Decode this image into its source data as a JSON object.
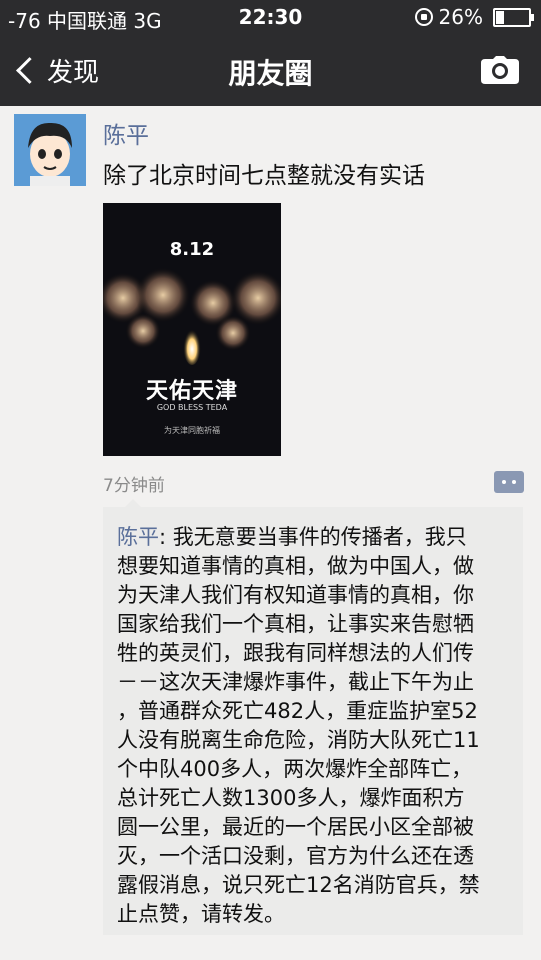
{
  "status": {
    "carrier": "-76 中国联通  3G",
    "time": "22:30",
    "battery": "26%",
    "battery_level": 0.26
  },
  "nav": {
    "back_label": "发现",
    "title": "朋友圈"
  },
  "post": {
    "author": "陈平",
    "text": "除了北京时间七点整就没有实话",
    "image": {
      "date": "8.12",
      "title": "天佑天津",
      "english": "GOD BLESS TEDA",
      "subtitle": "为天津同胞祈福"
    },
    "time_ago": "7分钟前"
  },
  "comment": {
    "author": "陈平",
    "lines": [
      ": 我无意要当事件的传播者，我只",
      "想要知道事情的真相，做为中国人，做",
      "为天津人我们有权知道事情的真相，你",
      "国家给我们一个真相，让事实来告慰牺",
      "牲的英灵们，跟我有同样想法的人们传",
      "－－这次天津爆炸事件，截止下午为止",
      "，普通群众死亡482人，重症监护室52",
      "人没有脱离生命危险，消防大队死亡11",
      "个中队400多人，两次爆炸全部阵亡，",
      "总计死亡人数1300多人，爆炸面积方",
      "圆一公里，最近的一个居民小区全部被",
      "灭，一个活口没剩，官方为什么还在透",
      "露假消息，说只死亡12名消防官兵，禁",
      "止点赞，请转发。"
    ]
  }
}
